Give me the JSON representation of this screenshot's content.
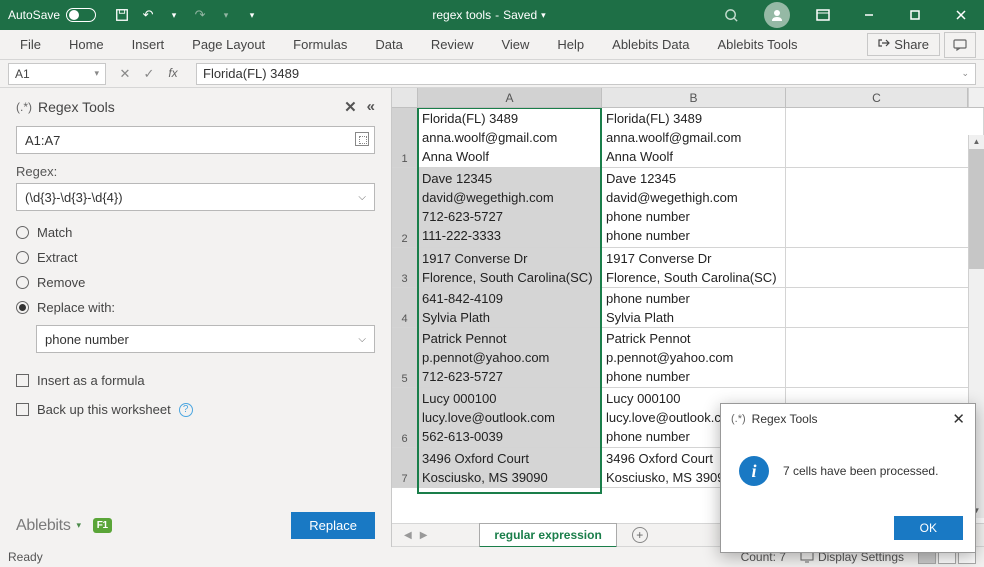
{
  "titlebar": {
    "autosave": "AutoSave",
    "filename": "regex tools",
    "saved": "Saved"
  },
  "ribbon": {
    "tabs": [
      "File",
      "Home",
      "Insert",
      "Page Layout",
      "Formulas",
      "Data",
      "Review",
      "View",
      "Help",
      "Ablebits Data",
      "Ablebits Tools"
    ],
    "share": "Share"
  },
  "formulabar": {
    "namebox": "A1",
    "formula": "Florida(FL) 3489"
  },
  "pane": {
    "title": "Regex Tools",
    "range": "A1:A7",
    "regex_label": "Regex:",
    "regex_value": "(\\d{3}-\\d{3}-\\d{4})",
    "option_match": "Match",
    "option_extract": "Extract",
    "option_remove": "Remove",
    "option_replace": "Replace with:",
    "replace_value": "phone number",
    "checkbox_formula": "Insert as a formula",
    "checkbox_backup": "Back up this worksheet",
    "brand": "Ablebits",
    "f1": "F1",
    "replace_btn": "Replace"
  },
  "grid": {
    "cols": [
      "A",
      "B",
      "C"
    ],
    "rows": [
      {
        "num": "1",
        "a": "Florida(FL) 3489\nanna.woolf@gmail.com\nAnna Woolf",
        "b": "Florida(FL) 3489\nanna.woolf@gmail.com\nAnna Woolf"
      },
      {
        "num": "2",
        "a": "Dave 12345\ndavid@wegethigh.com\n712-623-5727\n111-222-3333",
        "b": "Dave 12345\ndavid@wegethigh.com\nphone number\nphone number"
      },
      {
        "num": "3",
        "a": "1917 Converse Dr\nFlorence, South Carolina(SC)",
        "b": "1917 Converse Dr\nFlorence, South Carolina(SC)"
      },
      {
        "num": "4",
        "a": "641-842-4109\nSylvia Plath",
        "b": "phone number\nSylvia Plath"
      },
      {
        "num": "5",
        "a": "Patrick Pennot\np.pennot@yahoo.com\n712-623-5727",
        "b": "Patrick Pennot\np.pennot@yahoo.com\nphone number"
      },
      {
        "num": "6",
        "a": "Lucy 000100\nlucy.love@outlook.com\n562-613-0039",
        "b": "Lucy 000100\nlucy.love@outlook.com\nphone number"
      },
      {
        "num": "7",
        "a": "3496 Oxford Court\nKosciusko, MS 39090",
        "b": "3496 Oxford Court\nKosciusko, MS 39090"
      }
    ],
    "sheet_tab": "regular expression"
  },
  "statusbar": {
    "ready": "Ready",
    "count": "Count: 7",
    "display": "Display Settings"
  },
  "dialog": {
    "title": "Regex Tools",
    "message": "7 cells have been processed.",
    "ok": "OK"
  }
}
